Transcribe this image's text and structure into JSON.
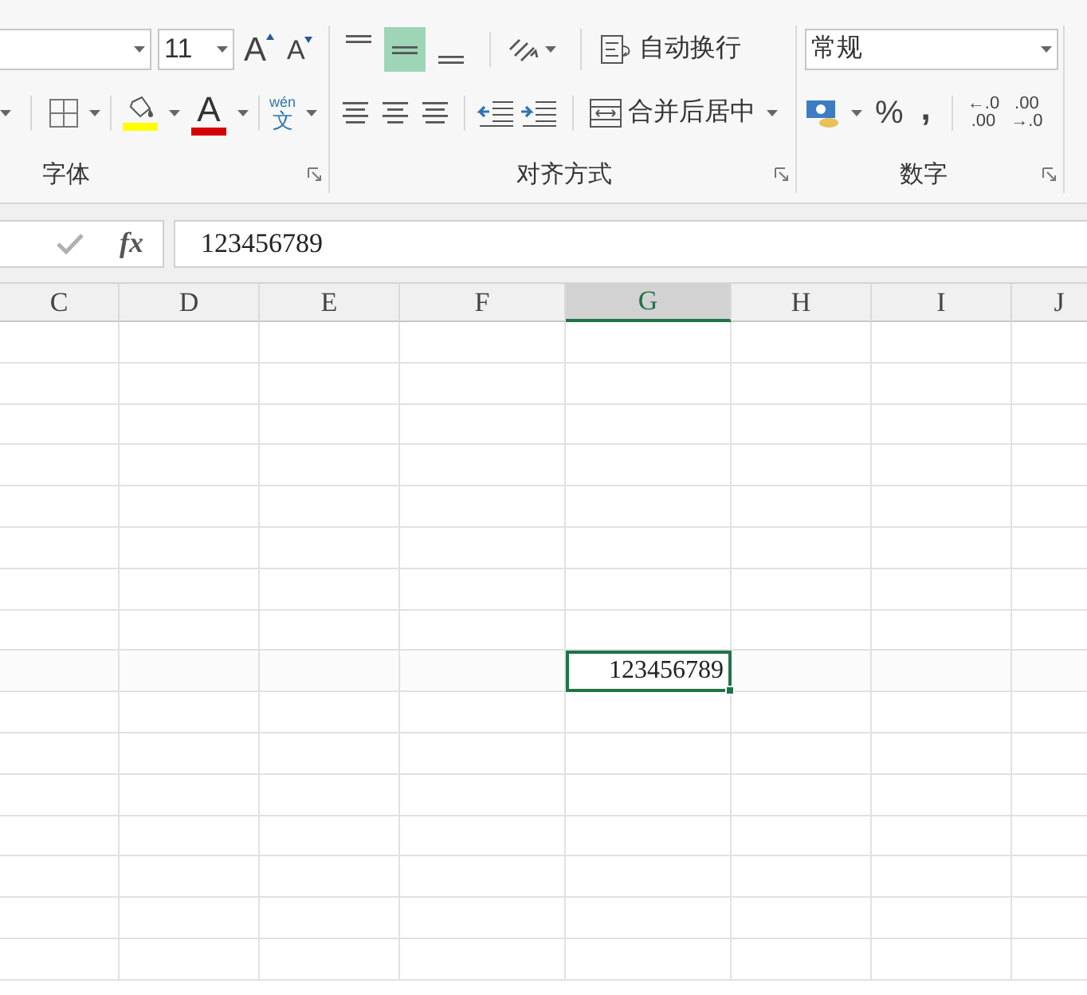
{
  "ribbon": {
    "font_group": {
      "label": "字体",
      "font_size": {
        "value": "11"
      },
      "grow_font": "A",
      "shrink_font": "A",
      "font_color": "A",
      "phonetic": {
        "top": "wén",
        "bottom": "文"
      }
    },
    "alignment_group": {
      "label": "对齐方式",
      "vertical_align": [
        {
          "kind": "top",
          "selected": false
        },
        {
          "kind": "middle",
          "selected": true
        },
        {
          "kind": "bottom",
          "selected": false
        }
      ],
      "wrap_text": "自动换行",
      "merge_center": "合并后居中"
    },
    "number_group": {
      "label": "数字",
      "format": {
        "value": "常规"
      },
      "percent": "%",
      "comma": ",",
      "increase_decimal": {
        "top": "←.0",
        "bottom": ".00"
      },
      "decrease_decimal": {
        "top": ".00",
        "bottom": "→.0"
      }
    }
  },
  "formula_bar": {
    "fx": "fx",
    "value": "123456789"
  },
  "columns": [
    {
      "label": "C",
      "selected": false
    },
    {
      "label": "D",
      "selected": false
    },
    {
      "label": "E",
      "selected": false
    },
    {
      "label": "F",
      "selected": false
    },
    {
      "label": "G",
      "selected": true
    },
    {
      "label": "H",
      "selected": false
    },
    {
      "label": "I",
      "selected": false
    },
    {
      "label": "J",
      "selected": false
    }
  ],
  "rows": [
    {
      "selected": false
    },
    {
      "selected": false
    },
    {
      "selected": false
    },
    {
      "selected": false
    },
    {
      "selected": false
    },
    {
      "selected": false
    },
    {
      "selected": false
    },
    {
      "selected": false
    },
    {
      "selected": true
    },
    {
      "selected": false
    },
    {
      "selected": false
    },
    {
      "selected": false
    },
    {
      "selected": false
    },
    {
      "selected": false
    },
    {
      "selected": false
    },
    {
      "selected": false
    }
  ],
  "active_cell": {
    "value": "123456789"
  }
}
